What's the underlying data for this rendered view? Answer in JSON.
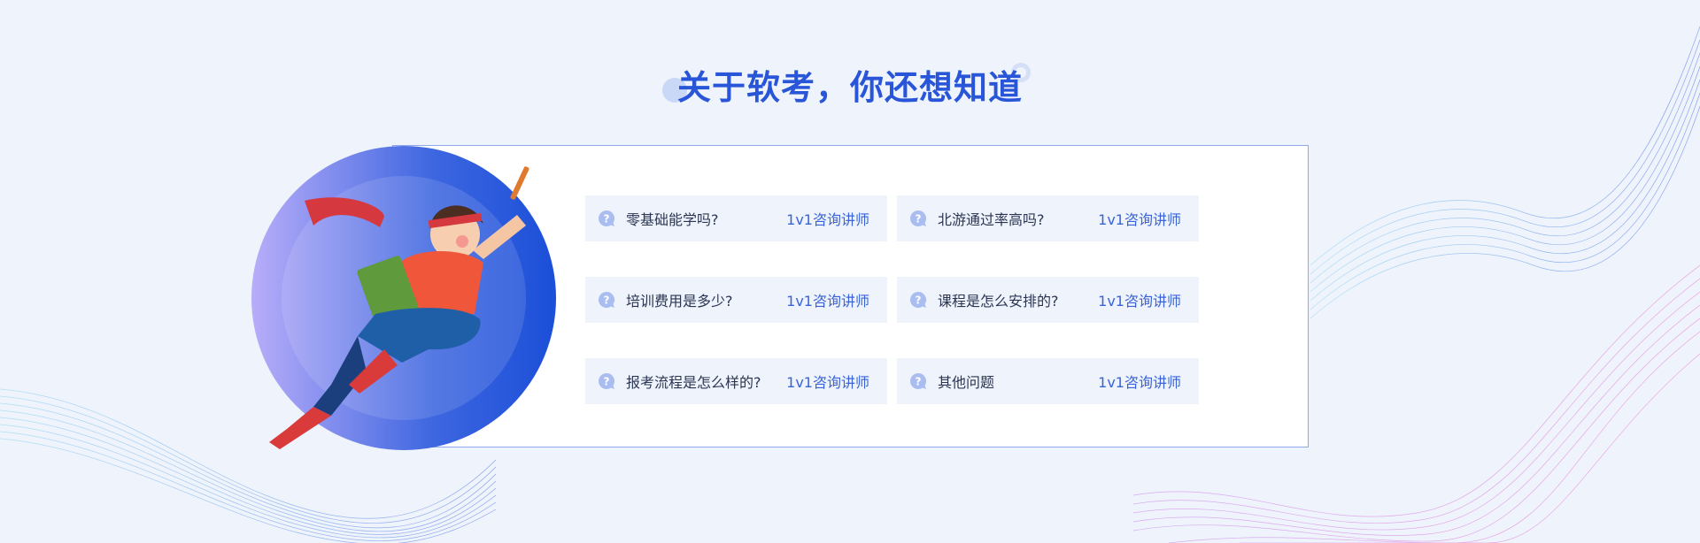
{
  "section": {
    "title": "关于软考，你还想知道"
  },
  "faq": {
    "items": [
      {
        "question": "零基础能学吗?",
        "link_label": "1v1咨询讲师"
      },
      {
        "question": "北游通过率高吗?",
        "link_label": "1v1咨询讲师"
      },
      {
        "question": "培训费用是多少?",
        "link_label": "1v1咨询讲师"
      },
      {
        "question": "课程是怎么安排的?",
        "link_label": "1v1咨询讲师"
      },
      {
        "question": "报考流程是怎么样的?",
        "link_label": "1v1咨询讲师"
      },
      {
        "question": "其他问题",
        "link_label": "1v1咨询讲师"
      }
    ]
  },
  "colors": {
    "background": "#eef3fc",
    "title": "#2956d8",
    "card_border": "#8fa8ee",
    "question_text": "#2b3552",
    "link_text": "#3a63d9",
    "item_background": "#eef3fc"
  },
  "icons": {
    "faq_item": "question-bubble-icon"
  }
}
